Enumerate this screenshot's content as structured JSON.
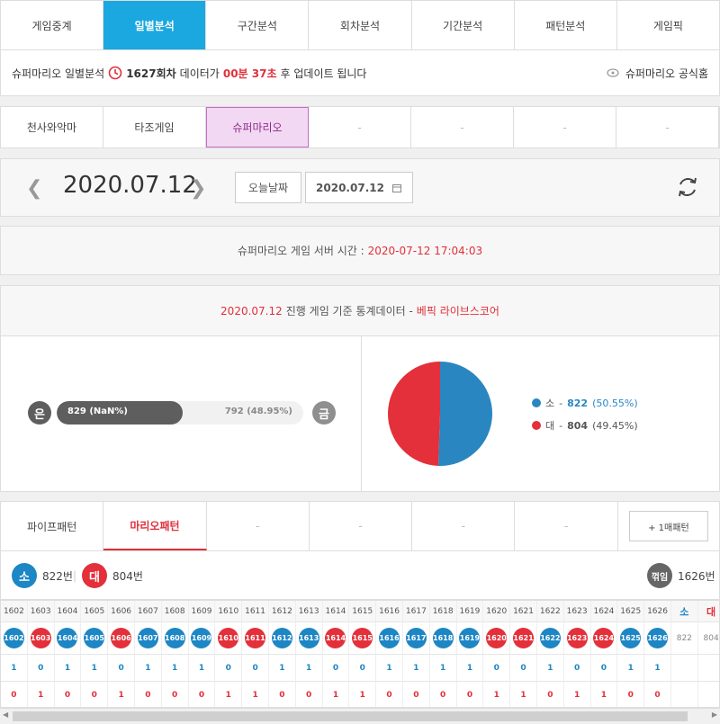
{
  "top_tabs": [
    "게임중계",
    "일별분석",
    "구간분석",
    "회차분석",
    "기간분석",
    "패턴분석",
    "게임픽"
  ],
  "info": {
    "prefix": "슈퍼마리오 일별분석",
    "round": "1627회차",
    "mid": "데이터가",
    "time": "00분 37초",
    "suffix": "후 업데이트 됩니다",
    "official": "슈퍼마리오 공식홈"
  },
  "games": [
    "천사와악마",
    "타조게임",
    "슈퍼마리오",
    "-",
    "-",
    "-",
    "-"
  ],
  "date": {
    "big": "2020.07.12",
    "today_btn": "오늘날짜",
    "picker": "2020.07.12"
  },
  "server": {
    "label": "슈퍼마리오 게임 서버 시간 :",
    "time": "2020-07-12 17:04:03"
  },
  "stats": {
    "header_date": "2020.07.12",
    "header_mid": "진행 게임 기준 통계데이터 -",
    "header_source": "베픽 라이브스코어",
    "left_label": "은",
    "right_label": "금",
    "bar_left": "829 (NaN%)",
    "bar_right": "792 (48.95%)",
    "bar_fill_fraction": 0.51,
    "legend": [
      {
        "label": "소",
        "value": "822",
        "pct": "(50.55%)",
        "color": "#2a86c0"
      },
      {
        "label": "대",
        "value": "804",
        "pct": "(49.45%)",
        "color": "#e3303a"
      }
    ],
    "pie_fraction_small": 0.5055
  },
  "pattern_tabs": [
    "파이프패턴",
    "마리오패턴",
    "-",
    "-",
    "-",
    "-"
  ],
  "pattern_btn": "+ 1매패턴",
  "summary": {
    "small": "소",
    "small_count": "822번",
    "large": "대",
    "large_count": "804번",
    "even": "꺾임",
    "even_count": "1626번"
  },
  "grid": {
    "rounds": [
      "1602",
      "1603",
      "1604",
      "1605",
      "1606",
      "1607",
      "1608",
      "1609",
      "1610",
      "1611",
      "1612",
      "1613",
      "1614",
      "1615",
      "1616",
      "1617",
      "1618",
      "1619",
      "1620",
      "1621",
      "1622",
      "1623",
      "1624",
      "1625",
      "1626"
    ],
    "result_color": [
      "b",
      "r",
      "b",
      "b",
      "r",
      "b",
      "b",
      "b",
      "r",
      "r",
      "b",
      "b",
      "r",
      "r",
      "b",
      "b",
      "b",
      "b",
      "r",
      "r",
      "b",
      "r",
      "r",
      "b",
      "b"
    ],
    "row_small": [
      "1",
      "0",
      "1",
      "1",
      "0",
      "1",
      "1",
      "1",
      "0",
      "0",
      "1",
      "1",
      "0",
      "0",
      "1",
      "1",
      "1",
      "1",
      "0",
      "0",
      "1",
      "0",
      "0",
      "1",
      "1"
    ],
    "row_large": [
      "0",
      "1",
      "0",
      "0",
      "1",
      "0",
      "0",
      "0",
      "1",
      "1",
      "0",
      "0",
      "1",
      "1",
      "0",
      "0",
      "0",
      "0",
      "1",
      "1",
      "0",
      "1",
      "1",
      "0",
      "0"
    ],
    "tail_head": [
      "소",
      "대"
    ],
    "tail_vals": [
      "822",
      "804"
    ]
  }
}
